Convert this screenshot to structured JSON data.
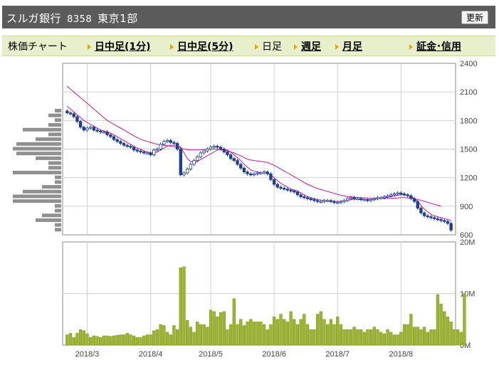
{
  "header": {
    "company": "スルガ銀行",
    "code": "8358",
    "market": "東京1部",
    "refresh_label": "更新"
  },
  "tabs": [
    {
      "label": "株価チャート",
      "link": false,
      "arrow": false
    },
    {
      "label": "日中足(1分)",
      "link": true,
      "arrow": true
    },
    {
      "label": "日中足(5分)",
      "link": true,
      "arrow": true
    },
    {
      "label": "日足",
      "link": false,
      "arrow": true
    },
    {
      "label": "週足",
      "link": true,
      "arrow": true
    },
    {
      "label": "月足",
      "link": true,
      "arrow": true
    },
    {
      "label": "証金･信用",
      "link": true,
      "arrow": true
    }
  ],
  "colors": {
    "candle": "#1f3f8f",
    "moving_avg_short": "#c0189a",
    "moving_avg_long": "#c0189a",
    "volume_bar": "#9cb531",
    "volume_profile": "#909090",
    "grid": "#d0d0d0"
  },
  "chart_data": [
    {
      "type": "candlestick",
      "y_ticks": [
        600,
        900,
        1200,
        1500,
        1800,
        2100,
        2400
      ],
      "ylim": [
        600,
        2400
      ],
      "x_tick_labels": [
        "2018/3",
        "2018/4",
        "2018/5",
        "2018/6",
        "2018/7",
        "2018/8"
      ],
      "x_tick_index": [
        6,
        25,
        43,
        62,
        81,
        100
      ],
      "close": [
        1880,
        1870,
        1840,
        1790,
        1730,
        1700,
        1720,
        1730,
        1700,
        1690,
        1680,
        1680,
        1650,
        1630,
        1600,
        1580,
        1560,
        1540,
        1530,
        1520,
        1490,
        1480,
        1470,
        1460,
        1460,
        1440,
        1490,
        1500,
        1550,
        1580,
        1590,
        1570,
        1560,
        1500,
        1230,
        1250,
        1290,
        1340,
        1380,
        1420,
        1460,
        1480,
        1500,
        1520,
        1530,
        1520,
        1500,
        1470,
        1440,
        1400,
        1380,
        1340,
        1300,
        1260,
        1240,
        1230,
        1240,
        1250,
        1250,
        1260,
        1240,
        1180,
        1130,
        1100,
        1090,
        1080,
        1070,
        1060,
        1050,
        1020,
        1000,
        990,
        980,
        970,
        960,
        950,
        950,
        960,
        960,
        950,
        940,
        940,
        950,
        960,
        980,
        990,
        980,
        980,
        970,
        970,
        960,
        970,
        980,
        990,
        990,
        1000,
        1010,
        1020,
        1030,
        1040,
        1030,
        1020,
        1010,
        980,
        950,
        880,
        830,
        800,
        790,
        780,
        770,
        760,
        750,
        740,
        720,
        650
      ],
      "ma_short": [
        1950,
        1920,
        1890,
        1860,
        1830,
        1800,
        1780,
        1760,
        1740,
        1720,
        1700,
        1690,
        1680,
        1670,
        1650,
        1630,
        1610,
        1590,
        1570,
        1550,
        1530,
        1510,
        1500,
        1480,
        1470,
        1460,
        1460,
        1470,
        1490,
        1510,
        1530,
        1540,
        1540,
        1540,
        1520,
        1460,
        1400,
        1370,
        1360,
        1370,
        1390,
        1410,
        1430,
        1450,
        1470,
        1490,
        1500,
        1500,
        1490,
        1470,
        1440,
        1410,
        1380,
        1340,
        1310,
        1280,
        1270,
        1260,
        1250,
        1250,
        1250,
        1230,
        1200,
        1170,
        1140,
        1120,
        1100,
        1080,
        1070,
        1060,
        1040,
        1020,
        1000,
        990,
        980,
        970,
        965,
        960,
        960,
        955,
        950,
        950,
        950,
        955,
        960,
        970,
        975,
        975,
        975,
        972,
        970,
        970,
        972,
        978,
        985,
        990,
        995,
        1000,
        1008,
        1015,
        1020,
        1020,
        1015,
        1000,
        980,
        950,
        910,
        870,
        840,
        815,
        800,
        790,
        780,
        770,
        760,
        750
      ],
      "ma_long": [
        2160,
        2130,
        2100,
        2070,
        2040,
        2010,
        1980,
        1950,
        1920,
        1890,
        1860,
        1830,
        1800,
        1780,
        1760,
        1740,
        1720,
        1700,
        1680,
        1660,
        1640,
        1620,
        1605,
        1590,
        1580,
        1570,
        1560,
        1550,
        1545,
        1540,
        1535,
        1530,
        1525,
        1520,
        1510,
        1500,
        1495,
        1490,
        1490,
        1490,
        1492,
        1495,
        1500,
        1500,
        1500,
        1498,
        1495,
        1490,
        1480,
        1470,
        1460,
        1445,
        1430,
        1410,
        1395,
        1385,
        1380,
        1375,
        1370,
        1365,
        1360,
        1345,
        1330,
        1310,
        1290,
        1270,
        1250,
        1230,
        1210,
        1190,
        1170,
        1150,
        1130,
        1115,
        1100,
        1085,
        1075,
        1065,
        1055,
        1045,
        1035,
        1025,
        1015,
        1008,
        1002,
        998,
        995,
        992,
        990,
        988,
        986,
        984,
        983,
        982,
        982,
        982,
        982,
        983,
        985,
        988,
        990,
        990,
        988,
        985,
        980,
        972,
        962,
        952,
        940,
        930,
        920,
        910,
        900
      ],
      "volume_profile_note": "horizontal volume-at-price bars on left edge"
    },
    {
      "type": "bar",
      "title": "",
      "y_ticks": [
        "0M",
        "10M",
        "20M"
      ],
      "ylim": [
        0,
        20
      ],
      "values": [
        2.0,
        2.3,
        1.5,
        2.3,
        3.0,
        2.8,
        2.2,
        1.5,
        1.8,
        1.7,
        1.5,
        1.8,
        1.8,
        1.7,
        1.8,
        1.9,
        2.0,
        2.0,
        2.3,
        2.0,
        1.8,
        1.5,
        1.5,
        1.8,
        2.0,
        2.0,
        2.8,
        3.0,
        4.0,
        3.8,
        2.5,
        2.0,
        3.8,
        3.0,
        15.0,
        15.2,
        4.8,
        3.5,
        2.5,
        4.5,
        4.0,
        4.0,
        3.5,
        6.8,
        6.5,
        5.5,
        6.3,
        6.5,
        3.0,
        4.0,
        9.0,
        4.0,
        5.0,
        3.8,
        4.5,
        5.0,
        4.5,
        4.5,
        4.5,
        4.0,
        3.0,
        4.0,
        5.5,
        5.0,
        6.0,
        5.0,
        4.5,
        6.5,
        5.0,
        4.0,
        5.0,
        6.0,
        4.0,
        3.0,
        3.0,
        6.0,
        6.5,
        5.0,
        4.0,
        5.0,
        4.0,
        5.5,
        4.0,
        3.0,
        3.0,
        3.0,
        3.5,
        3.0,
        3.0,
        2.5,
        3.0,
        3.0,
        3.5,
        3.0,
        2.5,
        2.2,
        3.0,
        2.5,
        2.0,
        2.0,
        2.5,
        4.0,
        4.0,
        6.0,
        3.5,
        3.5,
        3.0,
        3.5,
        2.5,
        3.0,
        3.0,
        9.8,
        8.0,
        6.5,
        5.5,
        4.5,
        3.0,
        3.0,
        2.5,
        10.0
      ]
    }
  ]
}
